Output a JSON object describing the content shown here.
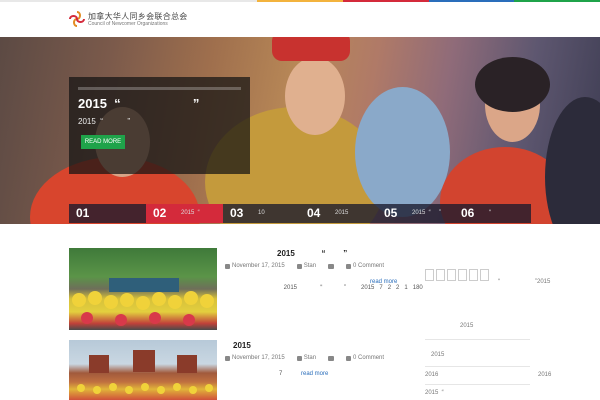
{
  "top_strip_colors": [
    "#e8e8e8",
    "#e8e8e8",
    "#e8e8e8",
    "#f3b33d",
    "#d42a3b",
    "#2a6ebb",
    "#1fa34a"
  ],
  "header": {
    "logo_cn": "加拿大华人同乡会联合总会",
    "logo_en": "Council of Newcomer Organizations"
  },
  "hero": {
    "caption_title": "2015  “                    ”",
    "caption_sub": "2015  “           ”",
    "read_more": "READ MORE",
    "tabs": [
      {
        "num": "01",
        "label": ""
      },
      {
        "num": "02",
        "label": "2015  “"
      },
      {
        "num": "03",
        "label": "10"
      },
      {
        "num": "04",
        "label": "2015"
      },
      {
        "num": "05",
        "label": "2015  “     ”"
      },
      {
        "num": "06",
        "label": "“"
      }
    ],
    "active_tab": 1,
    "accent_active": "#d42a3b",
    "button_color": "#1fa34a"
  },
  "posts": [
    {
      "title": "2015            “        ”",
      "date": "November 17, 2015",
      "author": "Stan",
      "comments": "0 Comment",
      "excerpt": "2015              “             ”         2015   7   2   2   1   180",
      "read_more": "read more"
    },
    {
      "title": "2015",
      "date": "November 17, 2015",
      "author": "Stan",
      "comments": "0 Comment",
      "excerpt": "7",
      "read_more": "read more"
    }
  ],
  "sidebar": {
    "right_text_1": "“                     ”2015",
    "items": [
      "2015",
      "2015",
      "2016",
      "2016",
      "2015  “"
    ]
  }
}
